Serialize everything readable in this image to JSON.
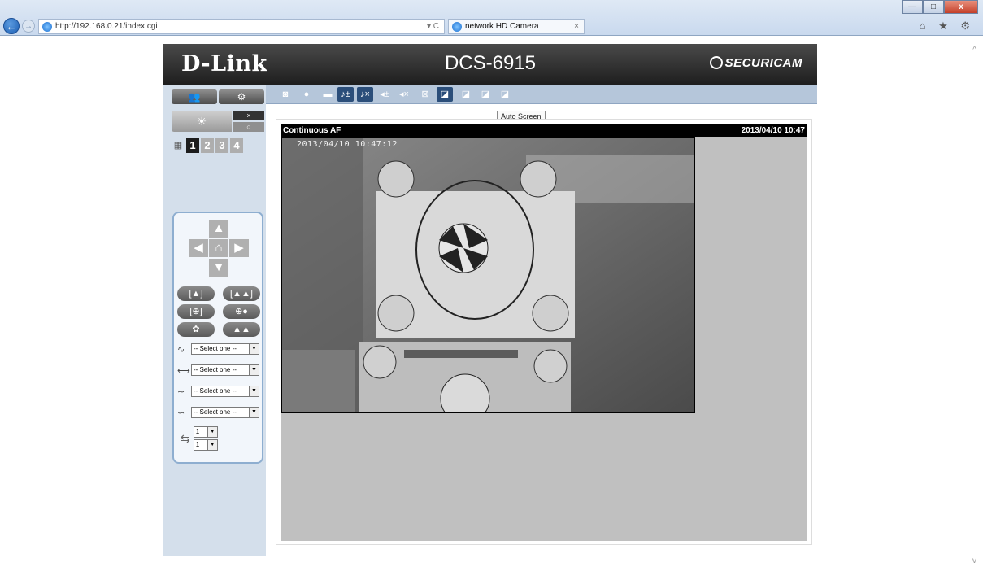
{
  "browser": {
    "url": "http://192.168.0.21/index.cgi",
    "tab_title": "network HD Camera",
    "tab_close": "×",
    "refresh": "▾ C",
    "window_controls": [
      "—",
      "□",
      "x"
    ],
    "right_icons": "⌂ ★ ⚙"
  },
  "header": {
    "brand": "D-Link",
    "model": "DCS-6915",
    "securicam": "SECURICAM"
  },
  "sidebar": {
    "top_buttons": [
      "👥",
      "⚙"
    ],
    "alarm": {
      "light_icon": "☀",
      "on": "×",
      "off": "○"
    },
    "preset_icon": "▦",
    "presets": [
      "1",
      "2",
      "3",
      "4"
    ],
    "dpad": {
      "up": "▲",
      "left": "◀",
      "home": "⌂",
      "right": "▶",
      "down": "▼"
    },
    "pills": [
      [
        "[▲]",
        "[▲▲]"
      ],
      [
        "[⊕]",
        "⊕●"
      ],
      [
        "✿",
        "▲▲"
      ]
    ],
    "selects": [
      {
        "icon": "∿",
        "value": "-- Select one --"
      },
      {
        "icon": "⟷",
        "value": "-- Select one --"
      },
      {
        "icon": "∼",
        "value": "-- Select one --"
      },
      {
        "icon": "∽",
        "value": "-- Select one --"
      }
    ],
    "speed": {
      "icon": "⇆",
      "pan": "1",
      "tilt": "1"
    }
  },
  "toolbar": {
    "tooltip": "Auto Screen"
  },
  "viewer": {
    "mode_label": "Continuous AF",
    "datetime": "2013/04/10 10:47",
    "osd_timestamp": "2013/04/10 10:47:12"
  }
}
